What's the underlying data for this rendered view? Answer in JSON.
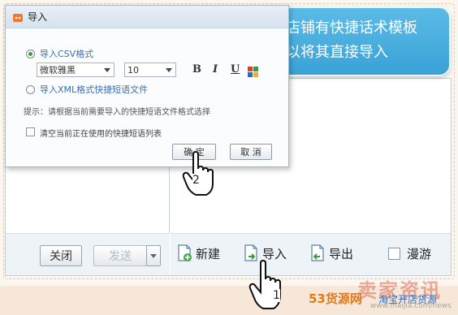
{
  "dialog": {
    "title": "导入",
    "option_csv": "导入CSV格式",
    "font_name": "微软雅黑",
    "font_size": "10",
    "bold_label": "B",
    "italic_label": "I",
    "underline_label": "U",
    "option_xml": "导入XML格式快捷短语文件",
    "hint": "提示：请根据当前需要导入的快捷短语文件格式选择",
    "clear_label": "清空当前正在使用的快捷短语列表",
    "ok_label": "确 定",
    "cancel_label": "取 消"
  },
  "callout": {
    "line1": "若店铺有快捷话术模板",
    "line2": "可以将其直接导入"
  },
  "main": {
    "close_label": "关闭",
    "send_label": "发送",
    "new_label": "新建",
    "import_label": "导入",
    "export_label": "导出",
    "roam_label": "漫游"
  },
  "steps": {
    "step1": "1",
    "step2": "2"
  },
  "watermark": {
    "brand": "53货源网",
    "taobao": "淘宝开店货源",
    "big": "卖家资讯",
    "url": "www.maijia.com/news"
  },
  "colors": {
    "accent_green": "#3f9a3c",
    "callout_blue": "#3aa2d6",
    "watermark_orange": "#e27a1a"
  }
}
